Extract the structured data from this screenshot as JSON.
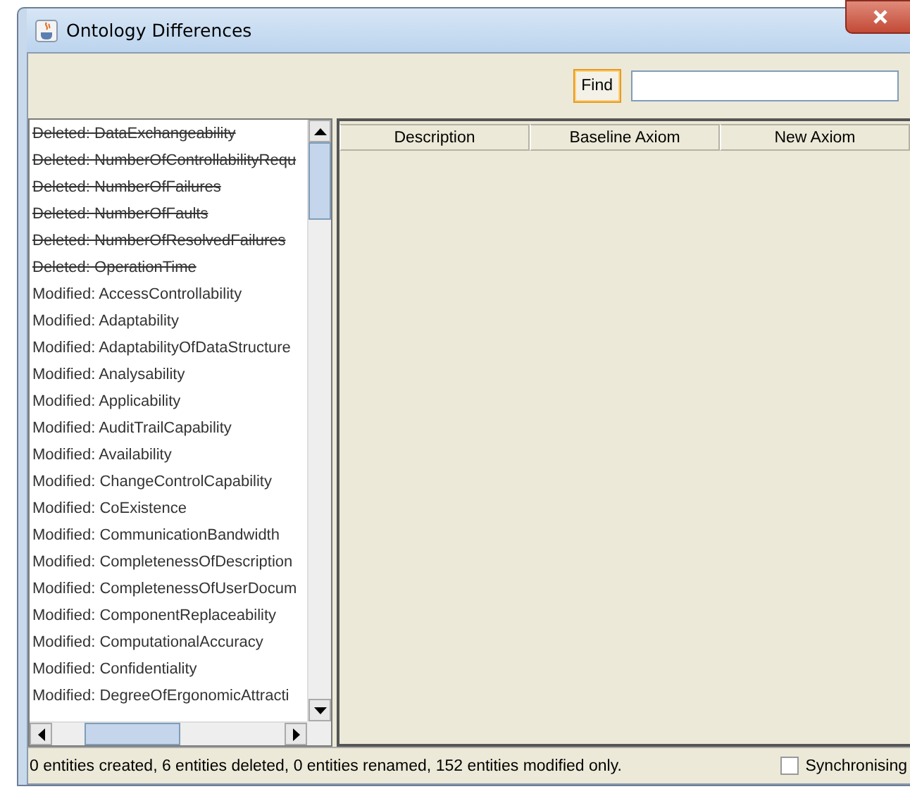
{
  "window": {
    "title": "Ontology Differences"
  },
  "toolbar": {
    "find_button": "Find"
  },
  "entities": [
    {
      "kind": "deleted",
      "label": "Deleted: DataExchangeability"
    },
    {
      "kind": "deleted",
      "label": "Deleted: NumberOfControllabilityRequ"
    },
    {
      "kind": "deleted",
      "label": "Deleted: NumberOfFailures"
    },
    {
      "kind": "deleted",
      "label": "Deleted: NumberOfFaults"
    },
    {
      "kind": "deleted",
      "label": "Deleted: NumberOfResolvedFailures"
    },
    {
      "kind": "deleted",
      "label": "Deleted: OperationTime"
    },
    {
      "kind": "modified",
      "label": "Modified: AccessControllability"
    },
    {
      "kind": "modified",
      "label": "Modified: Adaptability"
    },
    {
      "kind": "modified",
      "label": "Modified: AdaptabilityOfDataStructure"
    },
    {
      "kind": "modified",
      "label": "Modified: Analysability"
    },
    {
      "kind": "modified",
      "label": "Modified: Applicability"
    },
    {
      "kind": "modified",
      "label": "Modified: AuditTrailCapability"
    },
    {
      "kind": "modified",
      "label": "Modified: Availability"
    },
    {
      "kind": "modified",
      "label": "Modified: ChangeControlCapability"
    },
    {
      "kind": "modified",
      "label": "Modified: CoExistence"
    },
    {
      "kind": "modified",
      "label": "Modified: CommunicationBandwidth"
    },
    {
      "kind": "modified",
      "label": "Modified: CompletenessOfDescription"
    },
    {
      "kind": "modified",
      "label": "Modified: CompletenessOfUserDocum"
    },
    {
      "kind": "modified",
      "label": "Modified: ComponentReplaceability"
    },
    {
      "kind": "modified",
      "label": "Modified: ComputationalAccuracy"
    },
    {
      "kind": "modified",
      "label": "Modified: Confidentiality"
    },
    {
      "kind": "modified",
      "label": "Modified: DegreeOfErgonomicAttracti"
    }
  ],
  "table": {
    "columns": [
      "Description",
      "Baseline Axiom",
      "New Axiom"
    ]
  },
  "status_bar": {
    "summary": "0 entities created, 6 entities deleted, 0 entities renamed, 152 entities modified only.",
    "synchronising": {
      "label": "Synchronising",
      "checked": false
    }
  }
}
